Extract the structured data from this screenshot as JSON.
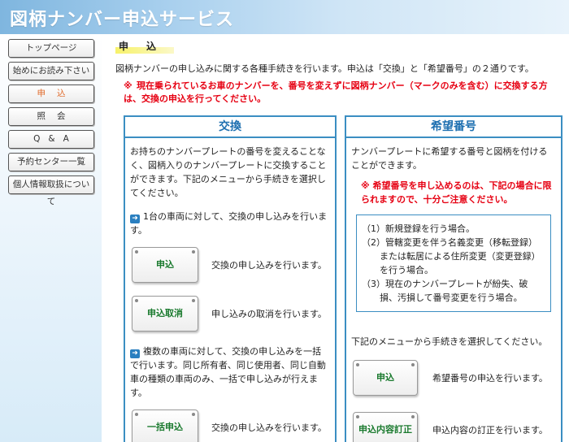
{
  "header": {
    "title": "図柄ナンバー申込サービス"
  },
  "nav": {
    "items": [
      {
        "label": "トップページ"
      },
      {
        "label": "始めにお読み下さい"
      },
      {
        "label": "申込"
      },
      {
        "label": "照会"
      },
      {
        "label": "Q&A"
      },
      {
        "label": "予約センター一覧"
      },
      {
        "label": "個人情報取扱について"
      }
    ]
  },
  "main": {
    "title": "申込",
    "intro": "図柄ナンバーの申し込みに関する各種手続きを行います。申込は「交換」と「希望番号」の２通りです。",
    "warning_mark": "※",
    "warning": "現在乗られているお車のナンバーを、番号を変えずに図柄ナンバー（マークのみを含む）に交換する方は、交換の申込を行ってください。"
  },
  "exchange": {
    "title": "交換",
    "desc": "お持ちのナンバープレートの番号を変えることなく、図柄入りのナンバープレートに交換することができます。下記のメニューから手続きを選択してください。",
    "single_note": "1台の車両に対して、交換の申し込みを行います。",
    "apply_label": "申込",
    "apply_desc": "交換の申し込みを行います。",
    "cancel_label": "申込取消",
    "cancel_desc": "申し込みの取消を行います。",
    "bulk_note": "複数の車両に対して、交換の申し込みを一括で行います。同じ所有者、同じ使用者、同じ自動車の種類の車両のみ、一括で申し込みが行えます。",
    "bulk_label": "一括申込",
    "bulk_desc": "交換の申し込みを行います。"
  },
  "desired": {
    "title": "希望番号",
    "desc": "ナンバープレートに希望する番号と図柄を付けることができます。",
    "warning_mark": "※",
    "warning": "希望番号を申し込めるのは、下記の場合に限られますので、十分ご注意ください。",
    "conditions": [
      "（1）新規登録を行う場合。",
      "（2）管轄変更を伴う名義変更（移転登録）または転居による住所変更（変更登録）を行う場合。",
      "（3）現在のナンバープレートが紛失、破損、汚損して番号変更を行う場合。"
    ],
    "menu_note": "下記のメニューから手続きを選択してください。",
    "apply_label": "申込",
    "apply_desc": "希望番号の申込を行います。",
    "correct_label": "申込内容訂正",
    "correct_desc": "申込内容の訂正を行います。"
  }
}
